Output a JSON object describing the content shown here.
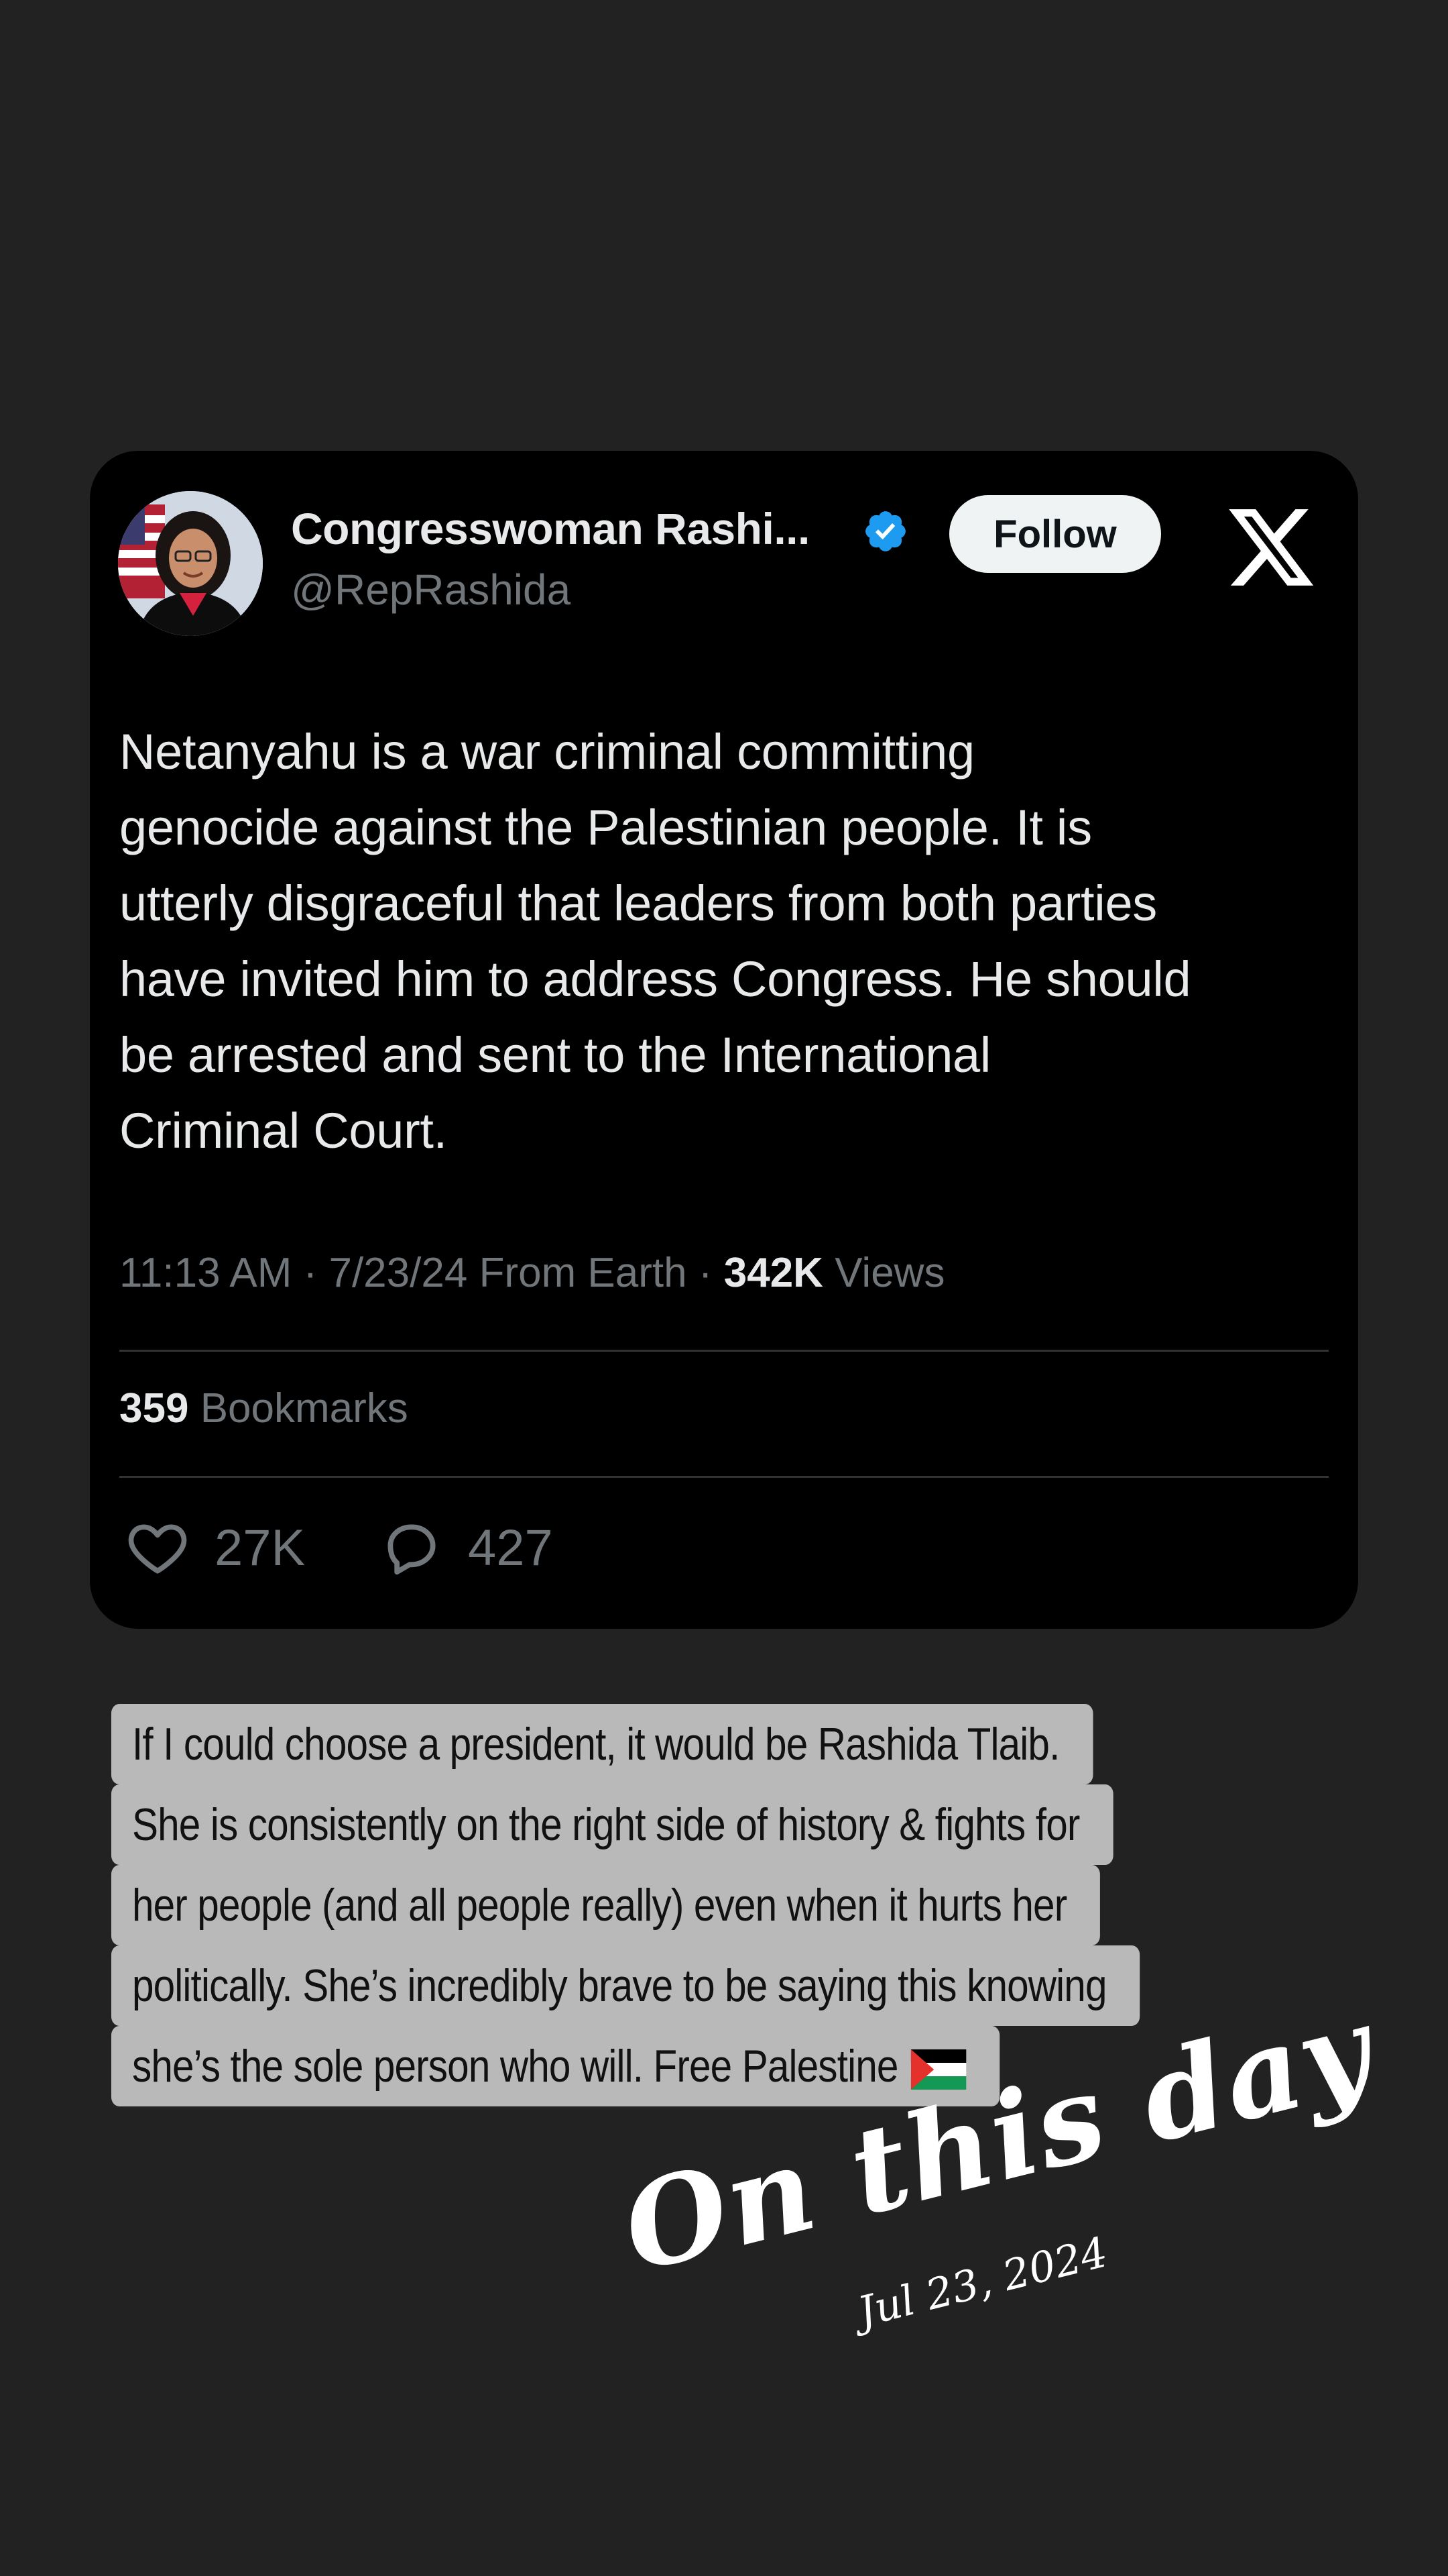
{
  "tweet": {
    "display_name": "Congresswoman Rashi...",
    "handle": "@RepRashida",
    "follow_label": "Follow",
    "text": "Netanyahu is a war criminal committing\ngenocide against the Palestinian people. It is\nutterly disgraceful that leaders from both parties\nhave invited him to address Congress. He should\nbe arrested and sent to the International\nCriminal Court.",
    "time": "11:13 AM",
    "date": "7/23/24",
    "source": "From Earth",
    "views_count": "342K",
    "views_label": "Views",
    "bookmarks_count": "359",
    "bookmarks_label": "Bookmarks",
    "likes_count": "27K",
    "replies_count": "427",
    "icons": [
      "verified-badge-icon",
      "x-logo-icon",
      "heart-icon",
      "reply-icon"
    ]
  },
  "caption": {
    "lines": [
      "If I could choose a president, it would be Rashida Tlaib.",
      "She is consistently on the right side of history & fights for",
      "her people (and all people really) even when it hurts her",
      "politically. She’s incredibly brave to be saying this knowing",
      "she’s the sole person who will. Free Palestine"
    ],
    "flag_icon": "palestine-flag-icon"
  },
  "sticker": {
    "title": "On this day",
    "date": "Jul 23, 2024"
  },
  "colors": {
    "background": "#222222",
    "card": "#000000",
    "text_primary": "#e7e9ea",
    "text_secondary": "#71767b",
    "verified_blue": "#1d9bf0",
    "caption_highlight": "#b9b9b9"
  }
}
